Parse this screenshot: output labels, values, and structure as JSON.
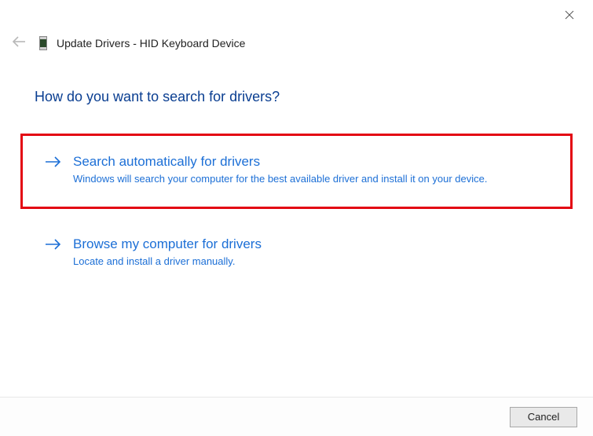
{
  "window": {
    "title": "Update Drivers - HID Keyboard Device"
  },
  "question": "How do you want to search for drivers?",
  "options": [
    {
      "title": "Search automatically for drivers",
      "description": "Windows will search your computer for the best available driver and install it on your device."
    },
    {
      "title": "Browse my computer for drivers",
      "description": "Locate and install a driver manually."
    }
  ],
  "buttons": {
    "cancel": "Cancel"
  }
}
